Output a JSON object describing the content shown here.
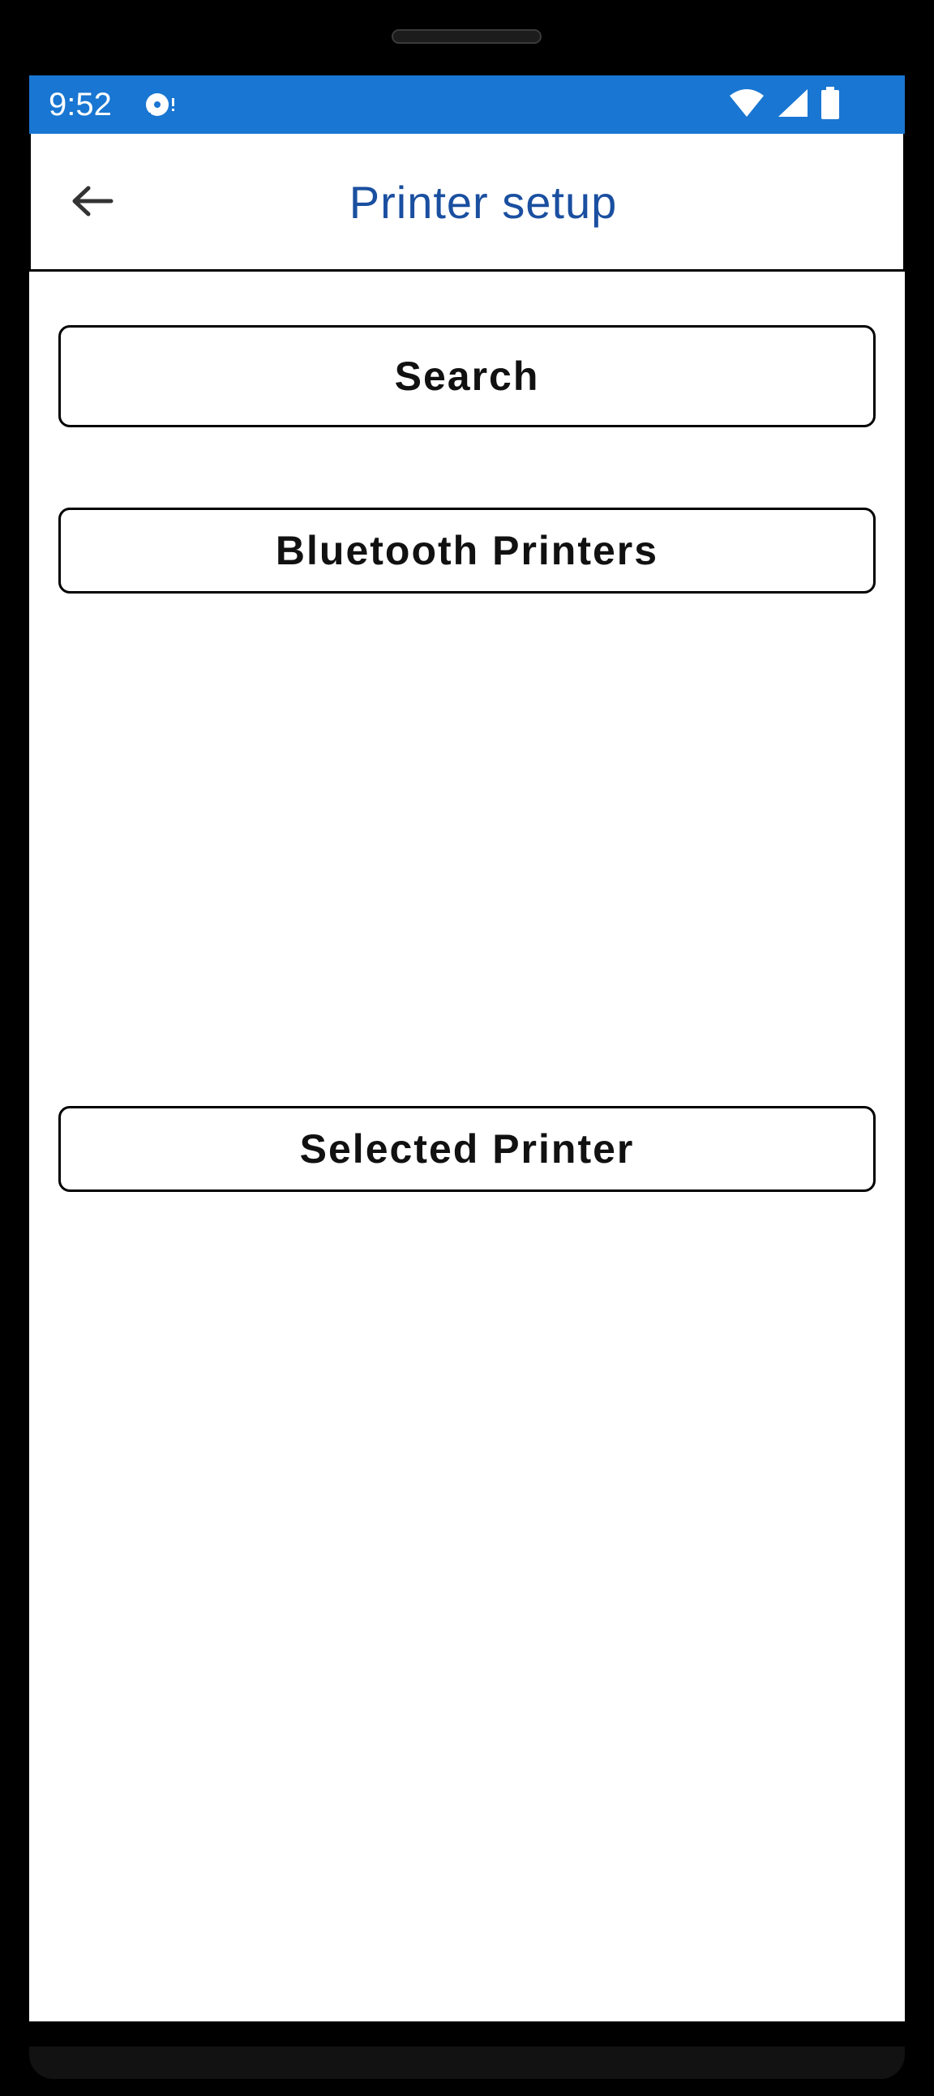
{
  "status_bar": {
    "time": "9:52",
    "notification_icon": "data-saver-icon",
    "wifi_icon": "wifi-icon",
    "signal_icon": "cell-signal-icon",
    "battery_icon": "battery-icon",
    "background_color": "#1976d2"
  },
  "app_bar": {
    "back_icon": "arrow-back-icon",
    "title": "Printer setup",
    "title_color": "#1a4fa0"
  },
  "main": {
    "search_label": "Search",
    "bluetooth_printers_label": "Bluetooth Printers",
    "selected_printer_label": "Selected Printer"
  }
}
